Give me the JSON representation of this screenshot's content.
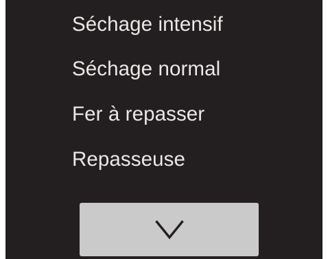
{
  "menu": {
    "items": [
      {
        "label": "Séchage intensif"
      },
      {
        "label": "Séchage normal"
      },
      {
        "label": "Fer à repasser"
      },
      {
        "label": "Repasseuse"
      }
    ]
  },
  "controls": {
    "scroll_down_icon": "chevron-down-icon"
  },
  "colors": {
    "screen_background": "#231f20",
    "menu_text": "#e9e8e6",
    "button_background": "#cbcacb",
    "icon": "#231f20"
  }
}
